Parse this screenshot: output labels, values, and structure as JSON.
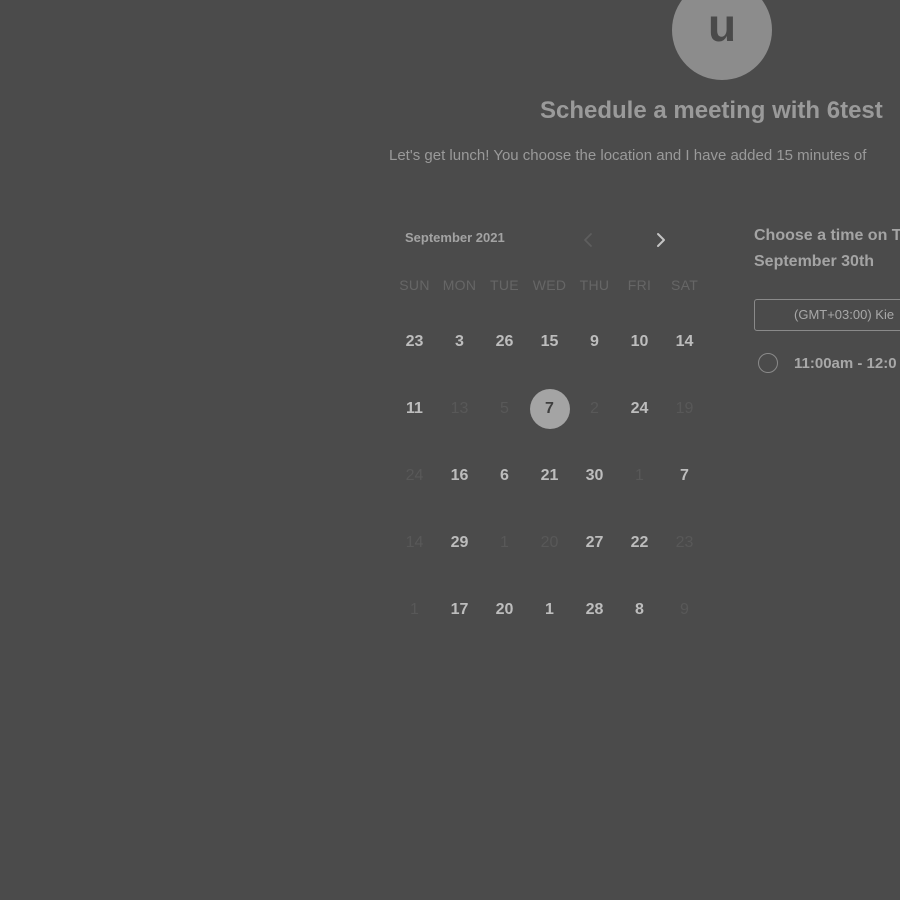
{
  "header": {
    "avatar_letter": "u",
    "title": "Schedule a meeting with 6test",
    "subtitle": "Let's get lunch! You choose the location and I have added 15 minutes of"
  },
  "calendar": {
    "month_label": "September 2021",
    "weekdays": [
      "SUN",
      "MON",
      "TUE",
      "WED",
      "THU",
      "FRI",
      "SAT"
    ],
    "days": [
      {
        "label": "23",
        "enabled": true
      },
      {
        "label": "3",
        "enabled": true
      },
      {
        "label": "26",
        "enabled": true
      },
      {
        "label": "15",
        "enabled": true
      },
      {
        "label": "9",
        "enabled": true
      },
      {
        "label": "10",
        "enabled": true
      },
      {
        "label": "14",
        "enabled": true
      },
      {
        "label": "11",
        "enabled": true
      },
      {
        "label": "13",
        "enabled": false
      },
      {
        "label": "5",
        "enabled": false
      },
      {
        "label": "7",
        "enabled": true,
        "selected": true
      },
      {
        "label": "2",
        "enabled": false
      },
      {
        "label": "24",
        "enabled": true
      },
      {
        "label": "19",
        "enabled": false
      },
      {
        "label": "24",
        "enabled": false
      },
      {
        "label": "16",
        "enabled": true
      },
      {
        "label": "6",
        "enabled": true
      },
      {
        "label": "21",
        "enabled": true
      },
      {
        "label": "30",
        "enabled": true
      },
      {
        "label": "1",
        "enabled": false
      },
      {
        "label": "7",
        "enabled": true
      },
      {
        "label": "14",
        "enabled": false
      },
      {
        "label": "29",
        "enabled": true
      },
      {
        "label": "1",
        "enabled": false
      },
      {
        "label": "20",
        "enabled": false
      },
      {
        "label": "27",
        "enabled": true
      },
      {
        "label": "22",
        "enabled": true
      },
      {
        "label": "23",
        "enabled": false
      },
      {
        "label": "1",
        "enabled": false
      },
      {
        "label": "17",
        "enabled": true
      },
      {
        "label": "20",
        "enabled": true
      },
      {
        "label": "1",
        "enabled": true
      },
      {
        "label": "28",
        "enabled": true
      },
      {
        "label": "8",
        "enabled": true
      },
      {
        "label": "9",
        "enabled": false
      }
    ]
  },
  "time_panel": {
    "choose_time": "Choose a time on T",
    "choose_time_date": "September 30th",
    "timezone": "(GMT+03:00) Kie",
    "slots": [
      "11:00am - 12:0"
    ]
  },
  "colors": {
    "overlay_background": "#4b4b4b",
    "selected_day": "#a4a4a4"
  },
  "icons": {
    "prev": "chevron-left-icon",
    "next": "chevron-right-icon"
  }
}
